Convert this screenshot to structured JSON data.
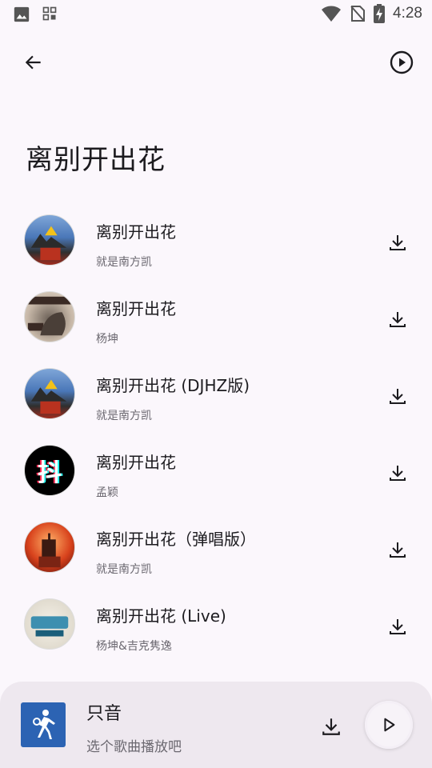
{
  "statusbar": {
    "time": "4:28"
  },
  "header": {
    "title": "离别开出花"
  },
  "songs": [
    {
      "title": "离别开出花",
      "artist": "就是南方凯",
      "cover": "cover-a"
    },
    {
      "title": "离别开出花",
      "artist": "杨坤",
      "cover": "cover-b"
    },
    {
      "title": "离别开出花 (DJHZ版)",
      "artist": "就是南方凯",
      "cover": "cover-a"
    },
    {
      "title": "离别开出花",
      "artist": "孟颖",
      "cover": "cover-c"
    },
    {
      "title": "离别开出花（弹唱版）",
      "artist": "就是南方凯",
      "cover": "cover-d"
    },
    {
      "title": "离别开出花 (Live)",
      "artist": "杨坤&吉克隽逸",
      "cover": "cover-e"
    }
  ],
  "cover_text": {
    "douyin": "抖"
  },
  "player": {
    "title": "只音",
    "subtitle": "选个歌曲播放吧"
  },
  "icons": {
    "back": "arrow-back-icon",
    "play_top": "play-circle-icon",
    "download": "download-icon",
    "play": "play-icon"
  },
  "colors": {
    "background": "#fbf7fc",
    "player_bg": "#eee8ef",
    "player_cover": "#2c63b3"
  }
}
